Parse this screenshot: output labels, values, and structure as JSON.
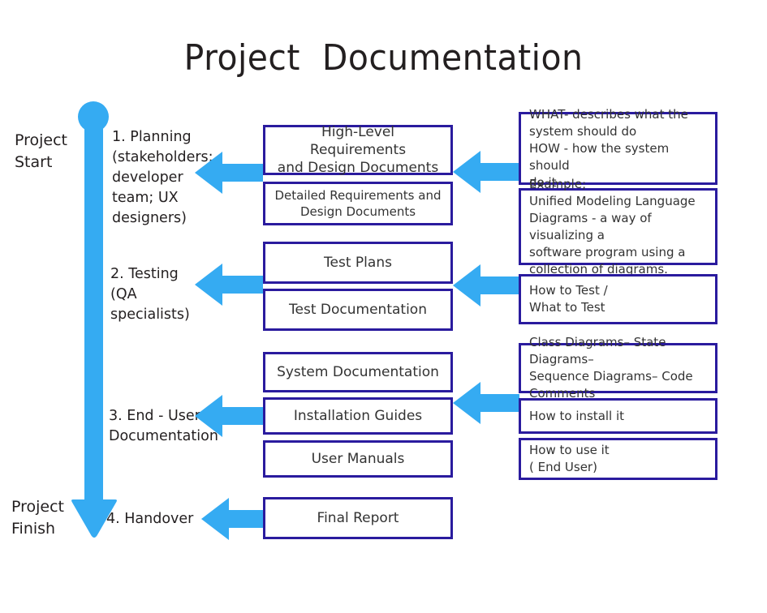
{
  "title": "Project  Documentation",
  "timeline": {
    "start_label": "Project\nStart",
    "finish_label": "Project\nFinish",
    "color": "#35ABF2"
  },
  "box_border_color": "#2A1B9E",
  "stages": [
    {
      "id": "planning",
      "label": "1. Planning\n(stakeholders;\ndeveloper\nteam; UX\ndesigners)"
    },
    {
      "id": "testing",
      "label": "2. Testing\n(QA\nspecialists)"
    },
    {
      "id": "end-user",
      "label": "3. End - User\nDocumentation"
    },
    {
      "id": "handover",
      "label": "4. Handover"
    }
  ],
  "documents": [
    {
      "id": "high-level-requirements",
      "label": "High-Level\nRequirements\nand Design Documents"
    },
    {
      "id": "detailed-requirements",
      "label": "Detailed Requirements and\nDesign Documents"
    },
    {
      "id": "test-plans",
      "label": "Test Plans"
    },
    {
      "id": "test-documentation",
      "label": "Test Documentation"
    },
    {
      "id": "system-documentation",
      "label": "System  Documentation"
    },
    {
      "id": "installation-guides",
      "label": "Installation Guides"
    },
    {
      "id": "user-manuals",
      "label": "User Manuals"
    },
    {
      "id": "final-report",
      "label": "Final Report"
    }
  ],
  "notes": [
    {
      "id": "what-how",
      "label": "WHAT- describes what the\nsystem should do\nHOW - how the system should\ndo it"
    },
    {
      "id": "uml-example",
      "label": "Example;\nUnified Modeling Language\nDiagrams - a way of visualizing a\nsoftware program using a\ncollection of diagrams."
    },
    {
      "id": "how-what-test",
      "label": "How to Test /\nWhat to Test"
    },
    {
      "id": "diagram-types",
      "label": "Class Diagrams– State Diagrams–\nSequence Diagrams– Code\nComments"
    },
    {
      "id": "how-to-install",
      "label": "How to install it"
    },
    {
      "id": "how-to-use",
      "label": "How to use it\n( End User)"
    }
  ]
}
